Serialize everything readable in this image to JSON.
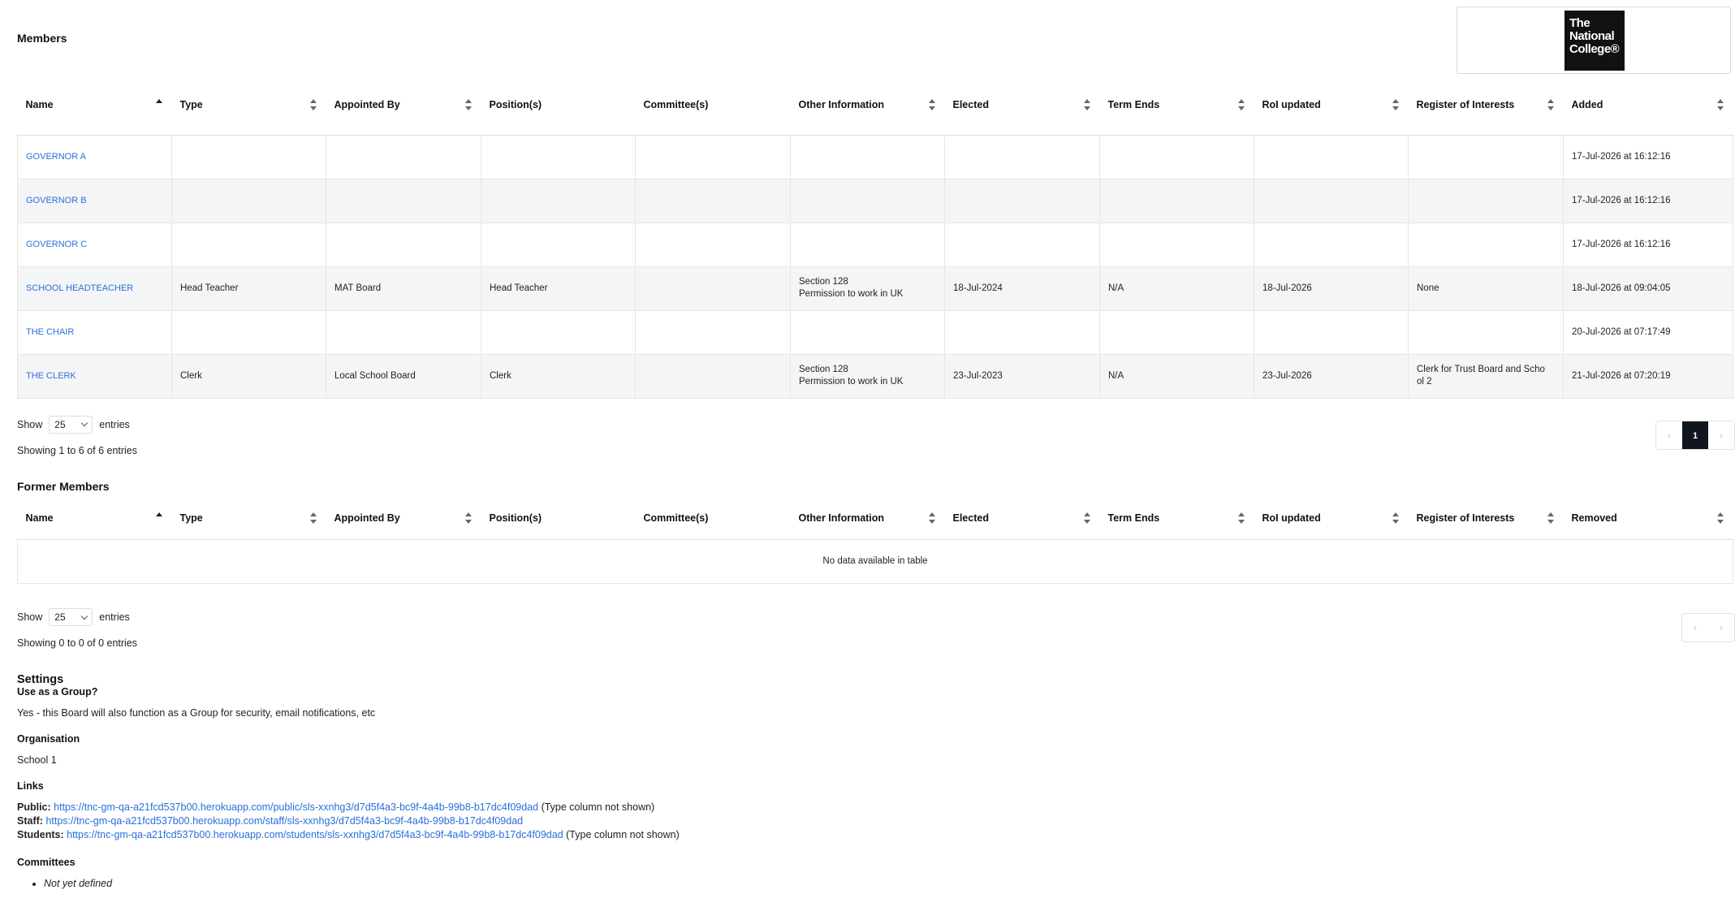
{
  "members": {
    "title": "Members",
    "columns": [
      "Name",
      "Type",
      "Appointed By",
      "Position(s)",
      "Committee(s)",
      "Other Information",
      "Elected",
      "Term Ends",
      "RoI updated",
      "Register of Interests",
      "Added"
    ],
    "rows": [
      {
        "name": "GOVERNOR A",
        "type": "",
        "appointed_by": "",
        "positions": "",
        "committees": "",
        "other_info_1": "",
        "other_info_2": "",
        "elected": "",
        "term_ends": "",
        "roi_updated": "",
        "register": "",
        "added": "17-Jul-2026 at 16:12:16"
      },
      {
        "name": "GOVERNOR B",
        "type": "",
        "appointed_by": "",
        "positions": "",
        "committees": "",
        "other_info_1": "",
        "other_info_2": "",
        "elected": "",
        "term_ends": "",
        "roi_updated": "",
        "register": "",
        "added": "17-Jul-2026 at 16:12:16"
      },
      {
        "name": "GOVERNOR C",
        "type": "",
        "appointed_by": "",
        "positions": "",
        "committees": "",
        "other_info_1": "",
        "other_info_2": "",
        "elected": "",
        "term_ends": "",
        "roi_updated": "",
        "register": "",
        "added": "17-Jul-2026 at 16:12:16"
      },
      {
        "name": "SCHOOL HEADTEACHER",
        "type": "Head Teacher",
        "appointed_by": "MAT Board",
        "positions": "Head Teacher",
        "committees": "",
        "other_info_1": "Section 128",
        "other_info_2": "Permission to work in UK",
        "elected": "18-Jul-2024",
        "term_ends": "N/A",
        "roi_updated": "18-Jul-2026",
        "register": "None",
        "added": "18-Jul-2026 at 09:04:05"
      },
      {
        "name": "THE CHAIR",
        "type": "",
        "appointed_by": "",
        "positions": "",
        "committees": "",
        "other_info_1": "",
        "other_info_2": "",
        "elected": "",
        "term_ends": "",
        "roi_updated": "",
        "register": "",
        "added": "20-Jul-2026 at 07:17:49"
      },
      {
        "name": "THE CLERK",
        "type": "Clerk",
        "appointed_by": "Local School Board",
        "positions": "Clerk",
        "committees": "",
        "other_info_1": "Section 128",
        "other_info_2": "Permission to work in UK",
        "elected": "23-Jul-2023",
        "term_ends": "N/A",
        "roi_updated": "23-Jul-2026",
        "register": "Clerk for Trust Board and Scho ol 2",
        "added": "21-Jul-2026 at 07:20:19"
      }
    ],
    "show_label": "Show",
    "page_size": "25",
    "entries_label": "entries",
    "info": "Showing 1 to 6 of 6 entries",
    "pager": {
      "prev": "‹",
      "current": "1",
      "next": "›"
    }
  },
  "logo": {
    "line1": "The",
    "line2": "National",
    "line3": "College®"
  },
  "former_members": {
    "title": "Former Members",
    "columns": [
      "Name",
      "Type",
      "Appointed By",
      "Position(s)",
      "Committee(s)",
      "Other Information",
      "Elected",
      "Term Ends",
      "RoI updated",
      "Register of Interests",
      "Removed"
    ],
    "empty": "No data available in table",
    "show_label": "Show",
    "page_size": "25",
    "entries_label": "entries",
    "info": "Showing 0 to 0 of 0 entries",
    "pager": {
      "prev": "‹",
      "next": "›"
    }
  },
  "settings": {
    "title": "Settings",
    "group_heading": "Use as a Group?",
    "group_value": "Yes - this Board will also function as a Group for security, email notifications, etc",
    "org_heading": "Organisation",
    "org_value": "School 1",
    "links_heading": "Links",
    "links": [
      {
        "label": "Public:",
        "url": "https://tnc-gm-qa-a21fcd537b00.herokuapp.com/public/sls-xxnhg3/d7d5f4a3-bc9f-4a4b-99b8-b17dc4f09dad",
        "note": " (Type column not shown)"
      },
      {
        "label": "Staff:",
        "url": "https://tnc-gm-qa-a21fcd537b00.herokuapp.com/staff/sls-xxnhg3/d7d5f4a3-bc9f-4a4b-99b8-b17dc4f09dad",
        "note": ""
      },
      {
        "label": "Students:",
        "url": "https://tnc-gm-qa-a21fcd537b00.herokuapp.com/students/sls-xxnhg3/d7d5f4a3-bc9f-4a4b-99b8-b17dc4f09dad",
        "note": " (Type column not shown)"
      }
    ],
    "committees_heading": "Committees",
    "committees_value": "Not yet defined"
  }
}
